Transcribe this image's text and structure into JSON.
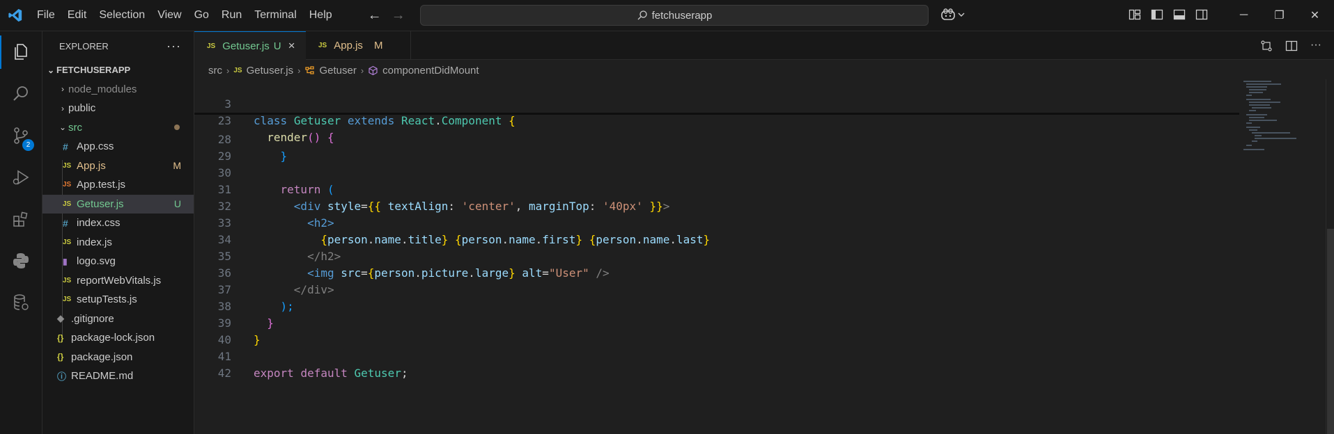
{
  "titlebar": {
    "menu": [
      "File",
      "Edit",
      "Selection",
      "View",
      "Go",
      "Run",
      "Terminal",
      "Help"
    ],
    "search_text": "fetchuserapp"
  },
  "activity": {
    "scm_badge": "2"
  },
  "sidebar": {
    "title": "EXPLORER",
    "more": "···",
    "project": "FETCHUSERAPP",
    "tree": {
      "node_modules": "node_modules",
      "public": "public",
      "src": "src",
      "app_css": "App.css",
      "app_js": "App.js",
      "app_js_status": "M",
      "app_test": "App.test.js",
      "getuser": "Getuser.js",
      "getuser_status": "U",
      "index_css": "index.css",
      "index_js": "index.js",
      "logo": "logo.svg",
      "report": "reportWebVitals.js",
      "setup": "setupTests.js",
      "gitignore": ".gitignore",
      "package_lock": "package-lock.json",
      "package": "package.json",
      "readme": "README.md"
    }
  },
  "icons": {
    "js": "JS",
    "css": "#",
    "json": "{}",
    "info": "ⓘ"
  },
  "tabs": [
    {
      "label": "Getuser.js",
      "status": "U",
      "close": "×"
    },
    {
      "label": "App.js",
      "status": "M"
    }
  ],
  "breadcrumbs": [
    "src",
    "Getuser.js",
    "Getuser",
    "componentDidMount"
  ],
  "editor": {
    "lines": [
      {
        "n": "3"
      },
      {
        "n": "23"
      },
      {
        "n": "28"
      },
      {
        "n": "29"
      },
      {
        "n": "30"
      },
      {
        "n": "31"
      },
      {
        "n": "32"
      },
      {
        "n": "33"
      },
      {
        "n": "34"
      },
      {
        "n": "35"
      },
      {
        "n": "36"
      },
      {
        "n": "37"
      },
      {
        "n": "38"
      },
      {
        "n": "39"
      },
      {
        "n": "40"
      },
      {
        "n": "41"
      },
      {
        "n": "42"
      }
    ],
    "tokens": {
      "class": "class",
      "getuser": "Getuser",
      "extends": "extends",
      "react": "React",
      "dot": ".",
      "component": "Component",
      "open_brace": "{",
      "close_brace": "}",
      "render": "render",
      "parens": "()",
      "open_paren": "(",
      "return": "return",
      "div_open": "<div",
      "style": "style",
      "eq": "=",
      "dbl_open": "{{",
      "dbl_close": "}}",
      "text_align": "textAlign",
      "colon": ":",
      "center": "'center'",
      "comma": ",",
      "margin_top": "marginTop",
      "px40": "'40px'",
      "gt": ">",
      "h2_open": "<h2>",
      "person": "person",
      "name": "name",
      "title": "title",
      "first": "first",
      "last": "last",
      "h2_close": "</h2>",
      "img": "<img",
      "src": "src",
      "picture": "picture",
      "large": "large",
      "alt": "alt",
      "user": "\"User\"",
      "self_close": "/>",
      "div_close": "</div>",
      "close_paren_semi": ");",
      "export": "export",
      "default": "default",
      "semi": ";"
    }
  }
}
